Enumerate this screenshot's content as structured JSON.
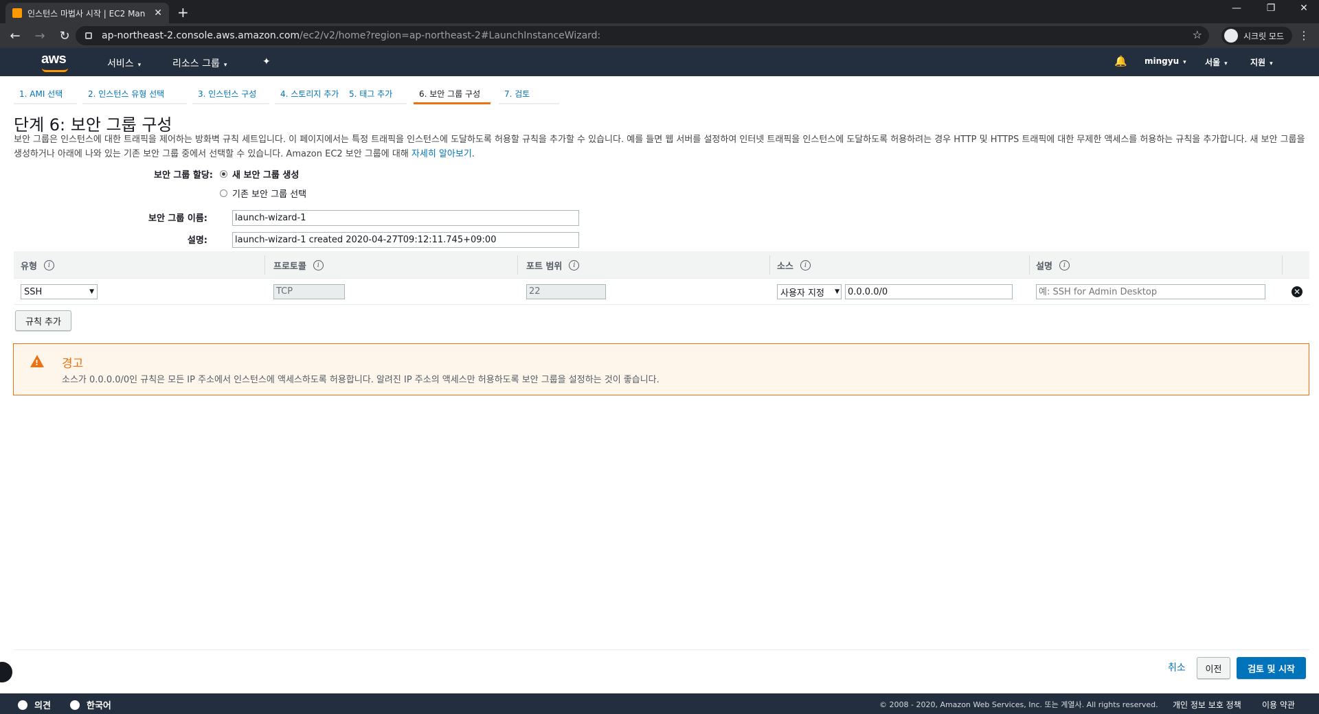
{
  "browser": {
    "tab_title": "인스턴스 마법사 시작 | EC2 Man",
    "tab_close": "✕",
    "new_tab": "+",
    "url_host": "ap-northeast-2.console.aws.amazon.com",
    "url_path": "/ec2/v2/home?region=ap-northeast-2#LaunchInstanceWizard:",
    "incognito_label": "시크릿 모드",
    "back": "←",
    "forward": "→",
    "reload": "↻",
    "star": "☆",
    "minimize": "—",
    "maximize": "❐",
    "close": "✕",
    "menu": "⋮"
  },
  "aws_nav": {
    "logo": "aws",
    "services": "서비스",
    "resource_groups": "리소스 그룹",
    "pin": "✦",
    "bell": "🔔",
    "user": "mingyu",
    "region": "서울",
    "support": "지원",
    "caret": "▾"
  },
  "wizard_steps": [
    {
      "label": "1. AMI 선택"
    },
    {
      "label": "2. 인스턴스 유형 선택"
    },
    {
      "label": "3. 인스턴스 구성"
    },
    {
      "label": "4. 스토리지 추가"
    },
    {
      "label": "5. 태그 추가"
    },
    {
      "label": "6. 보안 그룹 구성"
    },
    {
      "label": "7. 검토"
    }
  ],
  "page": {
    "title": "단계 6: 보안 그룹 구성",
    "description": "보안 그룹은 인스턴스에 대한 트래픽을 제어하는 방화벽 규칙 세트입니다. 이 페이지에서는 특정 트래픽을 인스턴스에 도달하도록 허용할 규칙을 추가할 수 있습니다. 예를 들면 웹 서버를 설정하여 인터넷 트래픽을 인스턴스에 도달하도록 허용하려는 경우 HTTP 및 HTTPS 트래픽에 대한 무제한 액세스를 허용하는 규칙을 추가합니다. 새 보안 그룹을 생성하거나 아래에 나와 있는 기존 보안 그룹 중에서 선택할 수 있습니다. Amazon EC2 보안 그룹에 대해 ",
    "learn_more": "자세히 알아보기",
    "period": "."
  },
  "form": {
    "assign_label": "보안 그룹 할당:",
    "option_new": "새 보안 그룹 생성",
    "option_existing": "기존 보안 그룹 선택",
    "name_label": "보안 그룹 이름:",
    "name_value": "launch-wizard-1",
    "desc_label": "설명:",
    "desc_value": "launch-wizard-1 created 2020-04-27T09:12:11.745+09:00"
  },
  "rules_table": {
    "headers": {
      "type": "유형",
      "protocol": "프로토콜",
      "port_range": "포트 범위",
      "source": "소스",
      "description": "설명"
    },
    "info": "i",
    "rows": [
      {
        "type": "SSH",
        "protocol": "TCP",
        "port_range": "22",
        "source_type": "사용자 지정",
        "source_cidr": "0.0.0.0/0",
        "description_placeholder": "예: SSH for Admin Desktop"
      }
    ],
    "remove": "✕",
    "add_rule": "규칙 추가"
  },
  "warning": {
    "title": "경고",
    "text": "소스가 0.0.0.0/0인 규칙은 모든 IP 주소에서 인스턴스에 액세스하도록 허용합니다. 알려진 IP 주소의 액세스만 허용하도록 보안 그룹을 설정하는 것이 좋습니다.",
    "icon": "!"
  },
  "actions": {
    "cancel": "취소",
    "previous": "이전",
    "review_launch": "검토 및 시작"
  },
  "footer": {
    "feedback": "의견",
    "language": "한국어",
    "copyright": "© 2008 - 2020, Amazon Web Services, Inc. 또는 계열사. All rights reserved.",
    "privacy": "개인 정보 보호 정책",
    "terms": "이용 약관"
  },
  "colors": {
    "aws_nav_bg": "#232f3e",
    "accent_orange": "#ec7211",
    "link_blue": "#0073bb"
  }
}
